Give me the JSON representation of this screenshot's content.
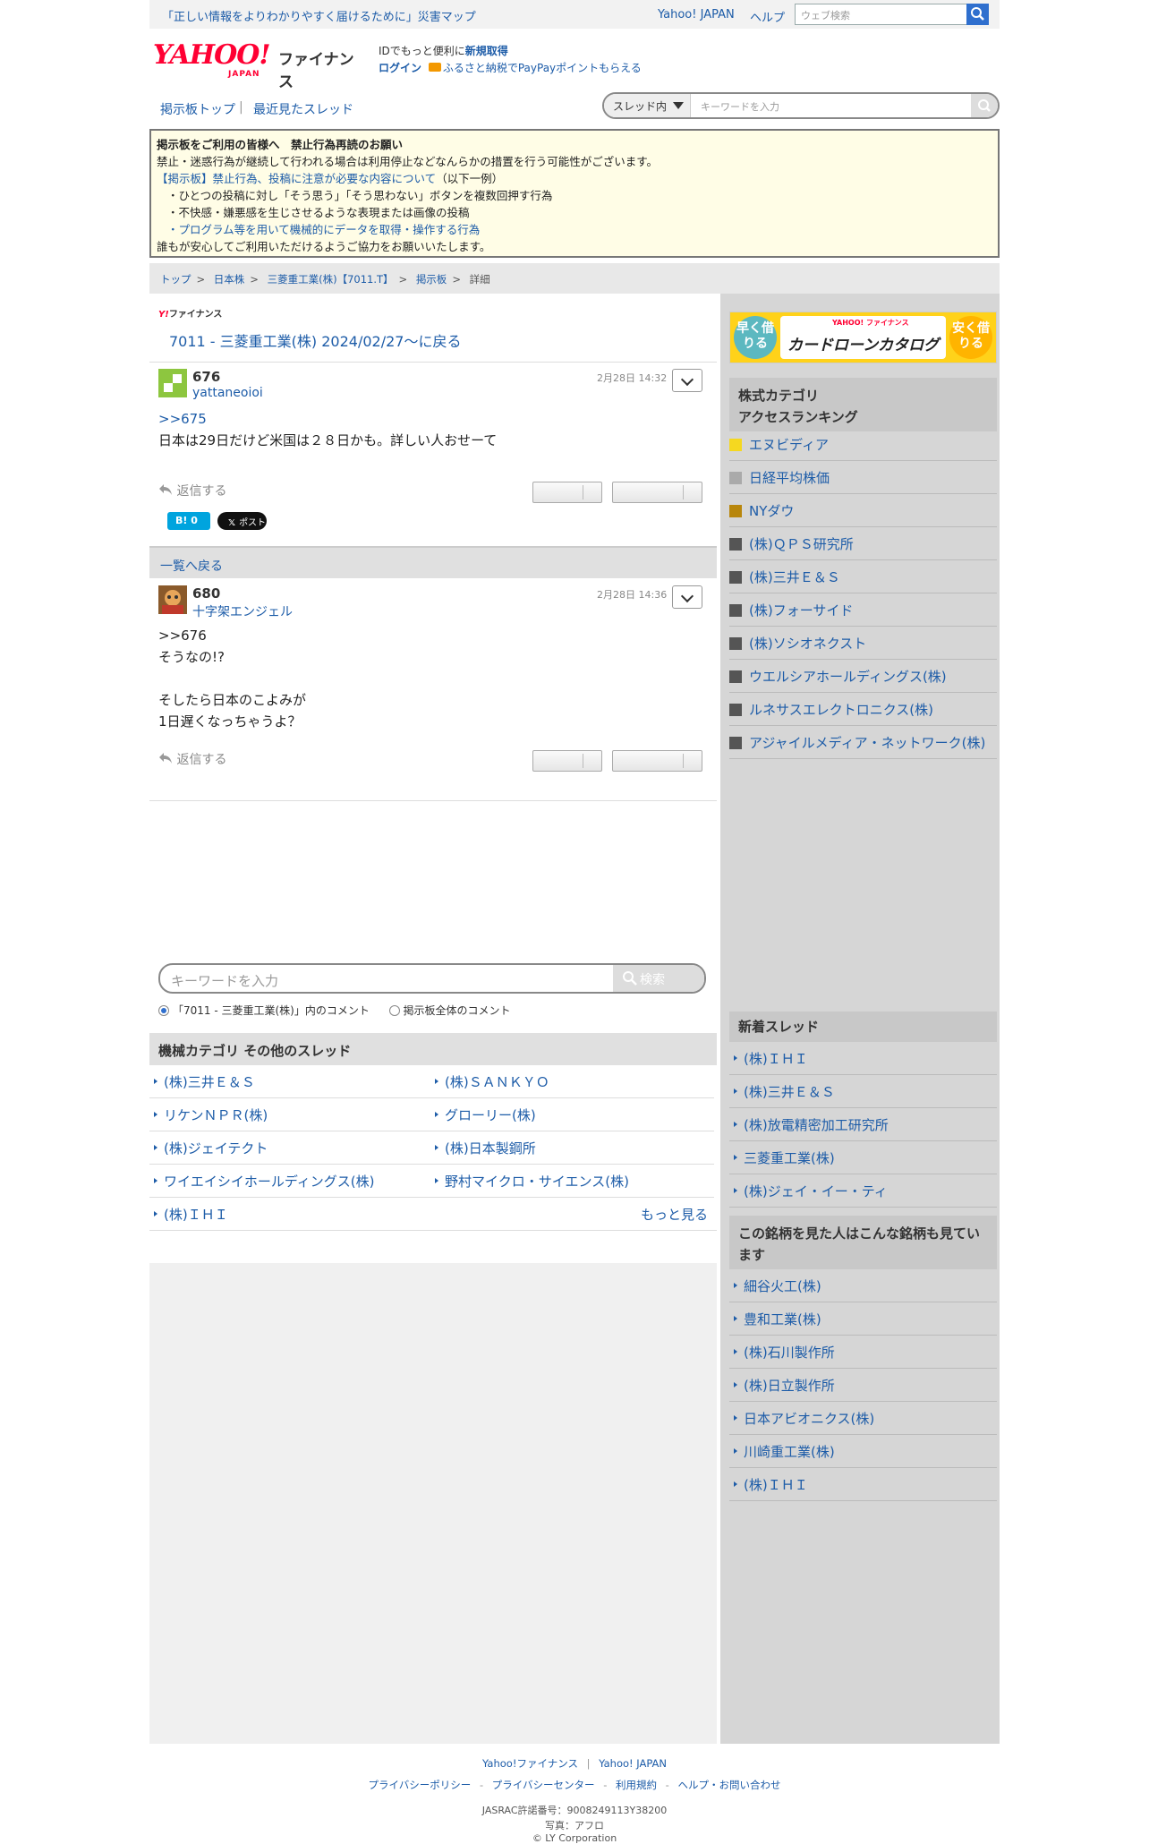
{
  "topbar": {
    "disaster_link": "「正しい情報をよりわかりやすく届けるために」災害マップ",
    "yahoo_japan": "Yahoo! JAPAN",
    "help": "ヘルプ",
    "web_search_placeholder": "ウェブ検索"
  },
  "header": {
    "logo_text": "YAHOO!",
    "logo_sub": "JAPAN",
    "logo_finance": "ファイナンス",
    "id_text": "IDでもっと便利に",
    "id_link": "新規取得",
    "login": "ログイン",
    "furusato": "ふるさと納税でPayPayポイントもらえる"
  },
  "nav": {
    "board_top": "掲示板トップ",
    "recent": "最近見たスレッド",
    "scope": "スレッド内",
    "keyword_placeholder": "キーワードを入力"
  },
  "notice": {
    "title": "掲示板をご利用の皆様へ　禁止行為再読のお願い",
    "line1": "禁止・迷惑行為が継続して行われる場合は利用停止などなんらかの措置を行う可能性がございます。",
    "line2_link": "【掲示板】禁止行為、投稿に注意が必要な内容について",
    "line2_rest": "（以下一例）",
    "item1": "・ひとつの投稿に対し「そう思う」「そう思わない」ボタンを複数回押す行為",
    "item2": "・不快感・嫌悪感を生じさせるような表現または画像の投稿",
    "item3": "・プログラム等を用いて機械的にデータを取得・操作する行為",
    "closing": "誰もが安心してご利用いただけるようご協力をお願いいたします。"
  },
  "breadcrumb": [
    "トップ",
    "日本株",
    "三菱重工業(株)【7011.T】",
    "掲示板",
    "詳細"
  ],
  "main": {
    "finance_small": "ファイナンス",
    "back_title": "7011 - 三菱重工業(株) 2024/02/27〜に戻る",
    "list_back": "一覧へ戻る",
    "reply": "返信する",
    "hatena": "B! 0",
    "x_post": "ポスト",
    "posts": [
      {
        "num": "676",
        "user": "yattaneoioi",
        "date": "2月28日 14:32",
        "anchor": ">>675",
        "lines": [
          "日本は29日だけど米国は２８日かも。詳しい人おせーて"
        ]
      },
      {
        "num": "680",
        "user": "十字架エンジェル",
        "date": "2月28日 14:36",
        "anchor": ">>676",
        "lines": [
          "そうなの!?",
          "",
          "そしたら日本のこよみが",
          "1日遅くなっちゃうよ？"
        ]
      }
    ],
    "keyword_placeholder": "キーワードを入力",
    "search_btn": "検索",
    "radio_thread": "「7011 - 三菱重工業(株)」内のコメント",
    "radio_all": "掲示板全体のコメント",
    "category_title": "機械カテゴリ その他のスレッド",
    "categories": [
      "(株)三井Ｅ＆Ｓ",
      "(株)ＳＡＮＫＹＯ",
      "リケンＮＰＲ(株)",
      "グローリー(株)",
      "(株)ジェイテクト",
      "(株)日本製鋼所",
      "ワイエイシイホールディングス(株)",
      "野村マイクロ・サイエンス(株)",
      "(株)ＩＨＩ"
    ],
    "more": "もっと見る"
  },
  "side": {
    "ad_left": "早く借りる",
    "ad_right": "安く借りる",
    "ad_brand": "YAHOO! ファイナンス",
    "ad_title": "カードローンカタログ",
    "ranking_title": "株式カテゴリ\nアクセスランキング",
    "ranking": [
      {
        "name": "エヌビディア",
        "color": "#f5d820"
      },
      {
        "name": "日経平均株価",
        "color": "#aaaaaa"
      },
      {
        "name": "NYダウ",
        "color": "#b8860b"
      },
      {
        "name": "(株)ＱＰＳ研究所",
        "color": "#555555"
      },
      {
        "name": "(株)三井Ｅ＆Ｓ",
        "color": "#555555"
      },
      {
        "name": "(株)フォーサイド",
        "color": "#555555"
      },
      {
        "name": "(株)ソシオネクスト",
        "color": "#555555"
      },
      {
        "name": "ウエルシアホールディングス(株)",
        "color": "#555555"
      },
      {
        "name": "ルネサスエレクトロニクス(株)",
        "color": "#555555"
      },
      {
        "name": "アジャイルメディア・ネットワーク(株)",
        "color": "#555555"
      }
    ],
    "new_threads_title": "新着スレッド",
    "new_threads": [
      "(株)ＩＨＩ",
      "(株)三井Ｅ＆Ｓ",
      "(株)放電精密加工研究所",
      "三菱重工業(株)",
      "(株)ジェイ・イー・ティ"
    ],
    "also_viewed_title": "この銘柄を見た人はこんな銘柄も見ています",
    "also_viewed": [
      "細谷火工(株)",
      "豊和工業(株)",
      "(株)石川製作所",
      "(株)日立製作所",
      "日本アビオニクス(株)",
      "川崎重工業(株)",
      "(株)ＩＨＩ"
    ]
  },
  "footer": {
    "yf": "Yahoo!ファイナンス",
    "yj": "Yahoo! JAPAN",
    "privacy_policy": "プライバシーポリシー",
    "privacy_center": "プライバシーセンター",
    "terms": "利用規約",
    "help_contact": "ヘルプ・お問い合わせ",
    "jasrac": "JASRAC許諾番号：9008249113Y38200",
    "photo": "写真：アフロ",
    "copyright": "© LY Corporation"
  }
}
